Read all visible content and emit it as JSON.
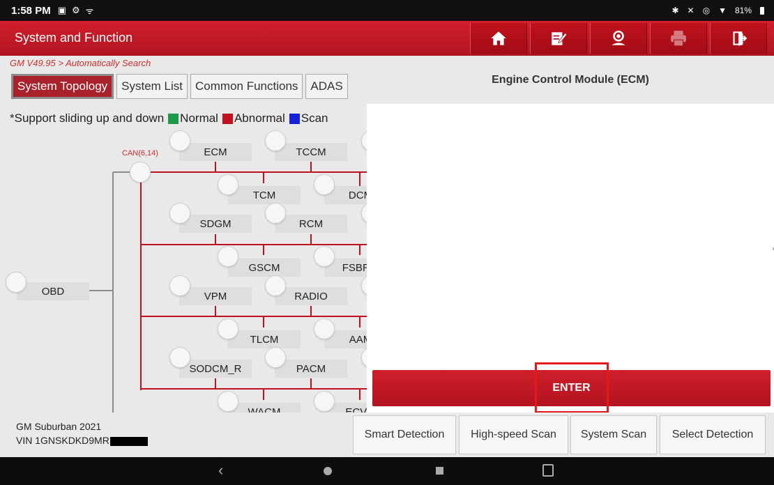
{
  "status_bar": {
    "time": "1:58 PM",
    "battery": "81%"
  },
  "title_bar": {
    "title": "System and Function",
    "buttons": [
      {
        "icon": "home-icon"
      },
      {
        "icon": "edit-report-icon"
      },
      {
        "icon": "user-support-icon"
      },
      {
        "icon": "print-icon",
        "disabled": true
      },
      {
        "icon": "exit-icon"
      }
    ]
  },
  "breadcrumb": "GM V49.95 > Automatically Search",
  "tabs": [
    {
      "label": "System Topology",
      "active": true
    },
    {
      "label": "System List"
    },
    {
      "label": "Common Functions"
    },
    {
      "label": "ADAS"
    }
  ],
  "legend": {
    "prefix": "*Support sliding up and down",
    "items": [
      {
        "label": "Normal",
        "color": "#1a9a4a"
      },
      {
        "label": "Abnormal",
        "color": "#c0111f"
      },
      {
        "label": "Scan",
        "color": "#1522d6"
      }
    ]
  },
  "topology": {
    "bus_label": "CAN(6,14)",
    "root": "OBD",
    "nodes": [
      "ECM",
      "TCCM",
      "TCM",
      "DCM",
      "SDGM",
      "RCM",
      "GSCM",
      "FSBRM",
      "VPM",
      "RADIO",
      "TLCM",
      "AAM",
      "SODCM_R",
      "PACM",
      "WACM",
      "ECVM"
    ]
  },
  "right_panel": {
    "header": "Engine Control Module (ECM)",
    "enter_label": "ENTER"
  },
  "vehicle": {
    "model": "GM Suburban 2021",
    "vin": "VIN 1GNSKDKD9MR"
  },
  "actions": [
    "Smart Detection",
    "High-speed Scan",
    "System Scan",
    "Select Detection"
  ],
  "colors": {
    "brand_red": "#c0151f",
    "line_red": "#c0111f",
    "line_gray": "#8a8a8a"
  }
}
